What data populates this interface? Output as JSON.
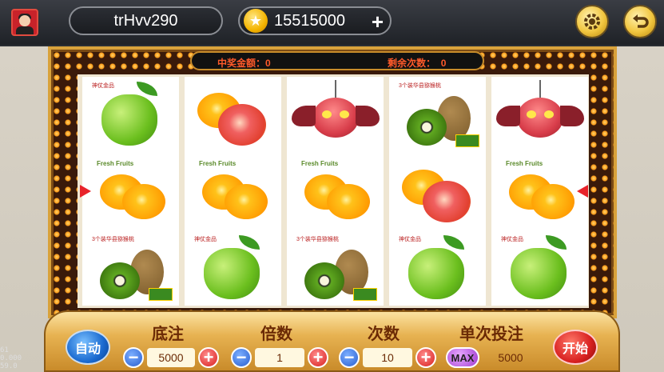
{
  "header": {
    "username": "trHvv290",
    "coins": "15515000",
    "coin_icon": "star-coin-icon",
    "add_coins": "+"
  },
  "info_bar": {
    "win_label": "中奖金额：",
    "win_value": "0",
    "remaining_label": "剩余次数：",
    "remaining_value": "0"
  },
  "reels": [
    [
      "apple",
      "orange",
      "kiwi"
    ],
    [
      "grapefruit",
      "orange",
      "apple"
    ],
    [
      "monster",
      "orange",
      "kiwi"
    ],
    [
      "kiwi",
      "grapefruit",
      "apple"
    ],
    [
      "monster",
      "orange",
      "apple"
    ]
  ],
  "labels": {
    "apple_tag": "神仗金品",
    "brand": "Fresh Fruits",
    "kiwi_tag": "3个装华县猕猴桃"
  },
  "controls": {
    "auto": "自动",
    "start": "开始",
    "bet_label": "底注",
    "bet_value": "5000",
    "multiplier_label": "倍数",
    "multiplier_value": "1",
    "times_label": "次数",
    "times_value": "10",
    "single_bet_label": "单次投注",
    "single_bet_value": "5000",
    "max": "MAX",
    "minus": "−",
    "plus": "+"
  },
  "debug": {
    "line1": "61",
    "line2": "0.000",
    "line3": "59.0"
  },
  "colors": {
    "frame_gold": "#d9a23b",
    "info_text": "#ff5a2a",
    "label_brown": "#6b2a05"
  }
}
